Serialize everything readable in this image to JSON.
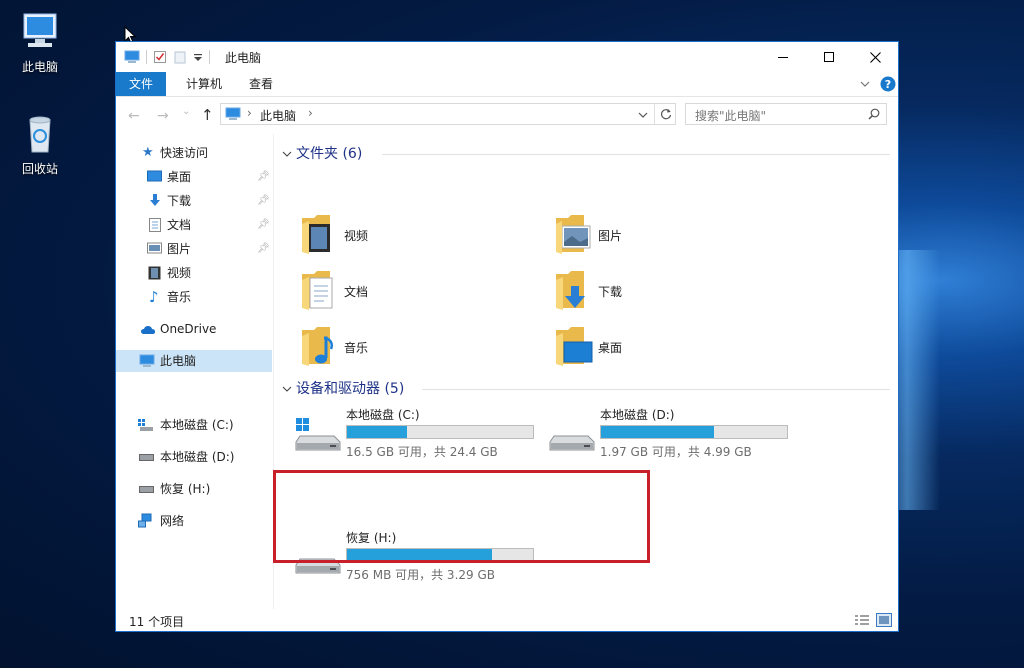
{
  "desktop": {
    "icons": [
      {
        "label": "此电脑",
        "icon": "computer-icon"
      },
      {
        "label": "回收站",
        "icon": "recycle-bin-icon"
      }
    ]
  },
  "window": {
    "title": "此电脑",
    "ribbon_tabs": [
      "文件",
      "计算机",
      "查看"
    ],
    "address": {
      "location": "此电脑"
    },
    "search": {
      "placeholder": "搜索\"此电脑\""
    }
  },
  "navpane": {
    "quick_access": "快速访问",
    "quick_items": [
      {
        "label": "桌面",
        "pinned": true
      },
      {
        "label": "下载",
        "pinned": true
      },
      {
        "label": "文档",
        "pinned": true
      },
      {
        "label": "图片",
        "pinned": true
      },
      {
        "label": "视频",
        "pinned": false
      },
      {
        "label": "音乐",
        "pinned": false
      }
    ],
    "onedrive": "OneDrive",
    "this_pc": "此电脑",
    "drives": [
      "本地磁盘 (C:)",
      "本地磁盘 (D:)",
      "恢复 (H:)"
    ],
    "network": "网络"
  },
  "content": {
    "folders_header": "文件夹 (6)",
    "folders": [
      "视频",
      "图片",
      "文档",
      "下载",
      "音乐",
      "桌面"
    ],
    "devices_header": "设备和驱动器 (5)",
    "drives": [
      {
        "name": "本地磁盘 (C:)",
        "free_text": "16.5 GB 可用，共 24.4 GB",
        "used_fraction": 0.32
      },
      {
        "name": "本地磁盘 (D:)",
        "free_text": "1.97 GB 可用，共 4.99 GB",
        "used_fraction": 0.61
      },
      {
        "name": "恢复 (H:)",
        "free_text": "756 MB 可用，共 3.29 GB",
        "used_fraction": 0.78
      }
    ]
  },
  "status": {
    "item_count": "11 个项目"
  },
  "colors": {
    "accent": "#1979ca",
    "drive_bar": "#26a0da",
    "highlight": "#c8202a"
  }
}
